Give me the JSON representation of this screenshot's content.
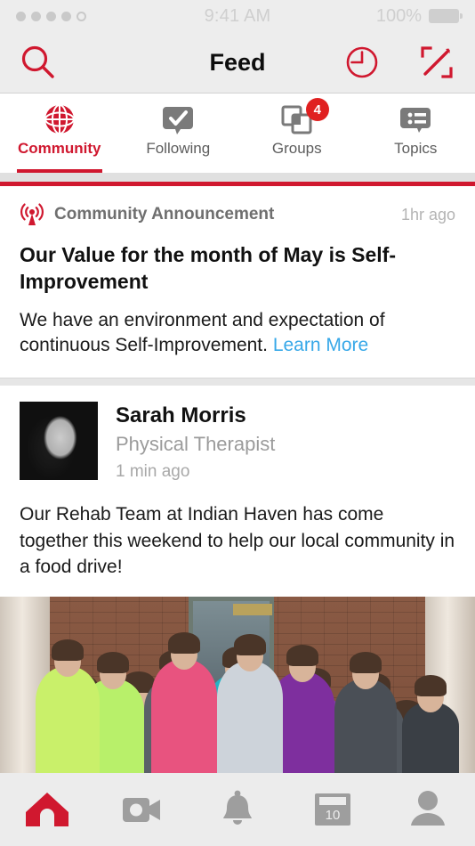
{
  "status_bar": {
    "signal_dots_filled": 4,
    "signal_dots_total": 5,
    "time": "9:41 AM",
    "battery_percent": "100%"
  },
  "nav_bar": {
    "title": "Feed",
    "search_icon": "search-icon",
    "recent_icon": "clock-icon",
    "compose_icon": "compose-icon"
  },
  "tabs": [
    {
      "label": "Community",
      "icon": "globe-icon",
      "active": true,
      "badge": ""
    },
    {
      "label": "Following",
      "icon": "check-bubble-icon",
      "active": false,
      "badge": ""
    },
    {
      "label": "Groups",
      "icon": "stacked-squares-icon",
      "active": false,
      "badge": "4"
    },
    {
      "label": "Topics",
      "icon": "list-bubble-icon",
      "active": false,
      "badge": ""
    }
  ],
  "announcement": {
    "icon": "broadcast-icon",
    "label": "Community Announcement",
    "time": "1hr ago",
    "headline": "Our Value for the month of May is Self-Improvement",
    "body": "We have an environment and expectation of continuous Self-Improvement.",
    "link_label": "Learn More"
  },
  "post": {
    "avatar_alt": "Sarah Morris profile photo",
    "author": "Sarah Morris",
    "role": "Physical Therapist",
    "time": "1 min ago",
    "body": "Our Rehab Team at Indian Haven has come together this weekend to help our local community in a food drive!",
    "image_alt": "Group photo of rehab team volunteers in front of brick building"
  },
  "bottom_nav": [
    {
      "name": "home",
      "icon": "home-icon",
      "active": true,
      "badge": ""
    },
    {
      "name": "video",
      "icon": "video-camera-icon",
      "active": false,
      "badge": ""
    },
    {
      "name": "notifications",
      "icon": "bell-icon",
      "active": false,
      "badge": ""
    },
    {
      "name": "calendar",
      "icon": "calendar-icon",
      "active": false,
      "badge": "10"
    },
    {
      "name": "profile",
      "icon": "person-icon",
      "active": false,
      "badge": ""
    }
  ],
  "colors": {
    "brand_red": "#d0182f",
    "badge_red": "#e02020",
    "link_blue": "#37a8e8",
    "grey_icon": "#7a7a7a"
  }
}
